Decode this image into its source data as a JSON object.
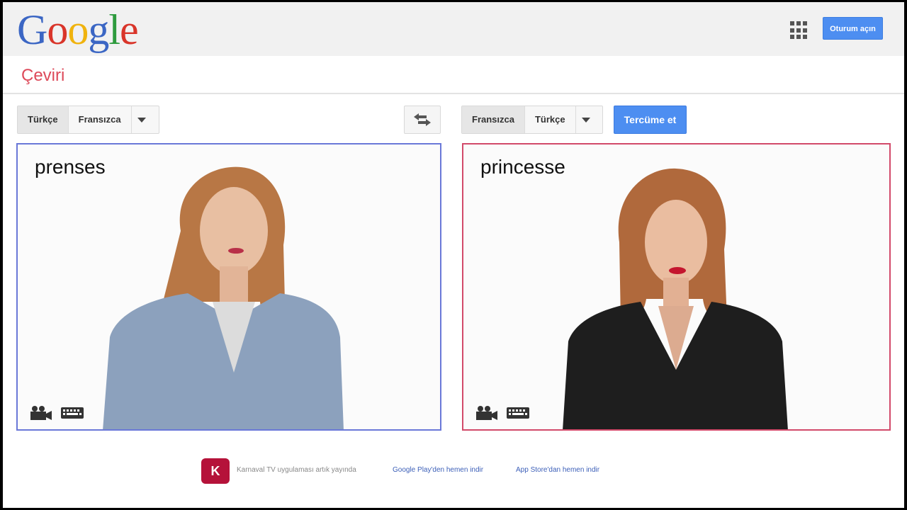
{
  "header": {
    "logo_letters": [
      "G",
      "o",
      "o",
      "g",
      "l",
      "e"
    ],
    "signin_label": "Oturum açın"
  },
  "page": {
    "subtitle": "Çeviri"
  },
  "source": {
    "langs": [
      "Türkçe",
      "Fransızca"
    ],
    "text": "prenses"
  },
  "target": {
    "langs": [
      "Fransızca",
      "Türkçe"
    ],
    "text": "princesse"
  },
  "toolbar": {
    "translate_label": "Tercüme et"
  },
  "footer": {
    "brand": "K TV",
    "promo": "Karnaval TV uygulaması artık yayında",
    "link_play": "Google Play'den hemen indir",
    "link_appstore": "App Store'dan hemen indir"
  },
  "colors": {
    "accent_blue": "#4d8ef1",
    "source_border": "#6a78d8",
    "target_border": "#d24a6a",
    "subtitle_red": "#dd4a5a"
  }
}
